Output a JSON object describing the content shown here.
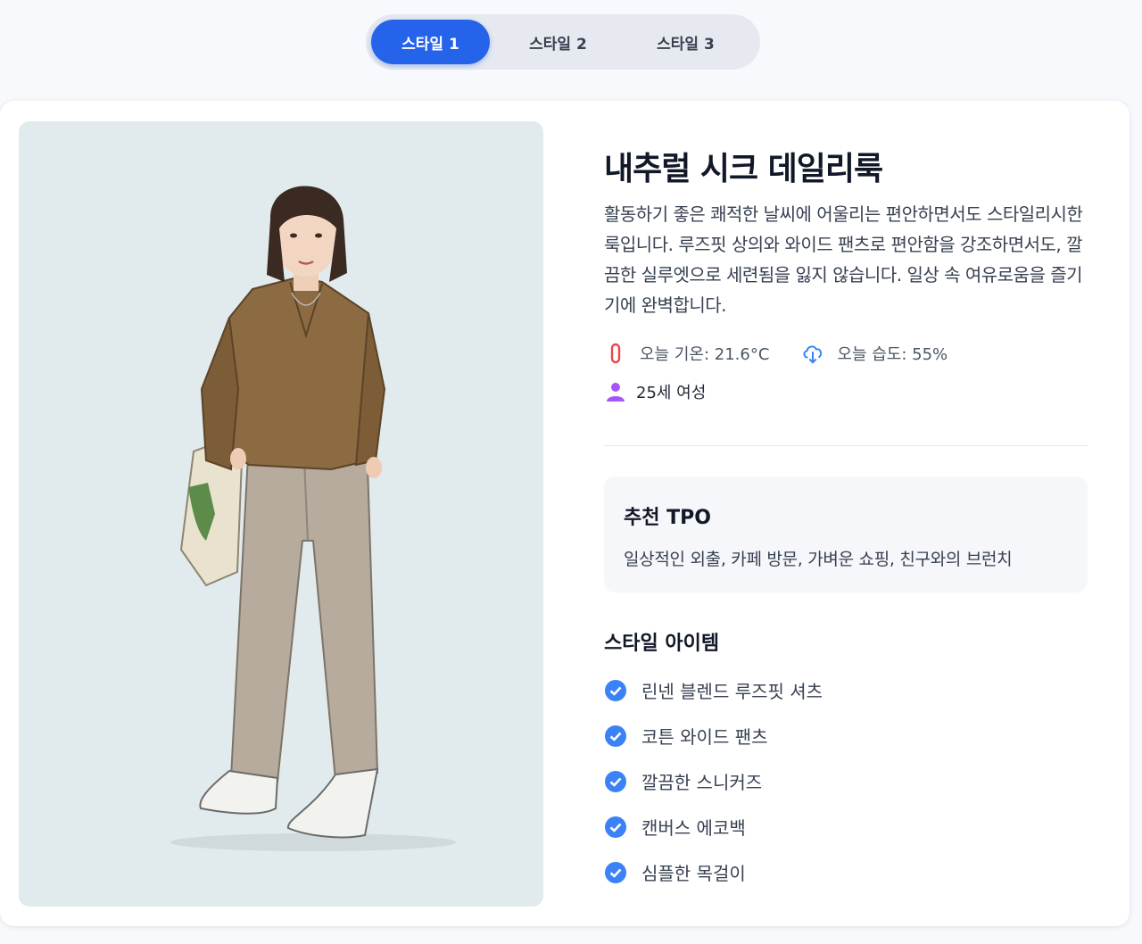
{
  "tabs": [
    {
      "label": "스타일 1",
      "active": true
    },
    {
      "label": "스타일 2",
      "active": false
    },
    {
      "label": "스타일 3",
      "active": false
    }
  ],
  "look": {
    "title": "내추럴 시크 데일리룩",
    "description": "활동하기 좋은 쾌적한 날씨에 어울리는 편안하면서도 스타일리시한 룩입니다. 루즈핏 상의와 와이드 팬츠로 편안함을 강조하면서도, 깔끔한 실루엣으로 세련됨을 잃지 않습니다. 일상 속 여유로움을 즐기기에 완벽합니다.",
    "temperature": "오늘 기온: 21.6°C",
    "humidity": "오늘 습도: 55%",
    "audience": "25세 여성"
  },
  "tpo": {
    "title": "추천 TPO",
    "text": "일상적인 외출, 카페 방문, 가벼운 쇼핑, 친구와의 브런치"
  },
  "items": {
    "title": "스타일 아이템",
    "list": [
      "린넨 블렌드 루즈핏 셔츠",
      "코튼 와이드 팬츠",
      "깔끔한 스니커즈",
      "캔버스 에코백",
      "심플한 목걸이"
    ]
  },
  "colors": {
    "accent": "#2563eb",
    "thermometer": "#ef4444",
    "person": "#a855f7",
    "check": "#3b82f6"
  }
}
